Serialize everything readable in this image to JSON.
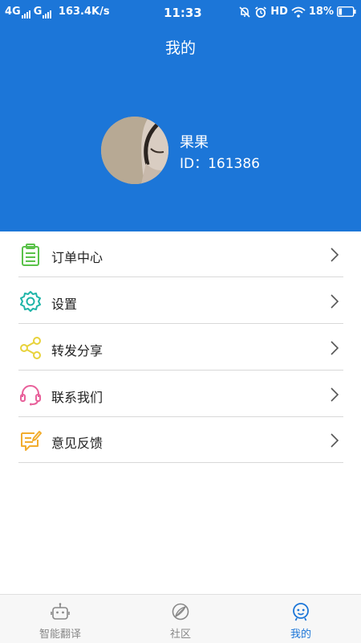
{
  "status_bar": {
    "left": "4G",
    "carrier": "G",
    "speed": "163.4K/s",
    "time": "11:33",
    "hd": "HD",
    "battery": "18%"
  },
  "page": {
    "title": "我的"
  },
  "user": {
    "name": "果果",
    "id_text": "ID：161386"
  },
  "menu": [
    {
      "label": "订单中心",
      "icon": "clipboard-icon",
      "color": "#5ac24a"
    },
    {
      "label": "设置",
      "icon": "gear-icon",
      "color": "#1fb5a8"
    },
    {
      "label": "转发分享",
      "icon": "share-icon",
      "color": "#e8d23a"
    },
    {
      "label": "联系我们",
      "icon": "headset-icon",
      "color": "#e8609a"
    },
    {
      "label": "意见反馈",
      "icon": "feedback-icon",
      "color": "#f2ad2e"
    }
  ],
  "bottom_nav": [
    {
      "label": "智能翻译",
      "icon": "robot-icon",
      "active": false
    },
    {
      "label": "社区",
      "icon": "community-icon",
      "active": false
    },
    {
      "label": "我的",
      "icon": "profile-icon",
      "active": true
    }
  ],
  "colors": {
    "primary": "#1c76d8",
    "inactive": "#888888"
  }
}
